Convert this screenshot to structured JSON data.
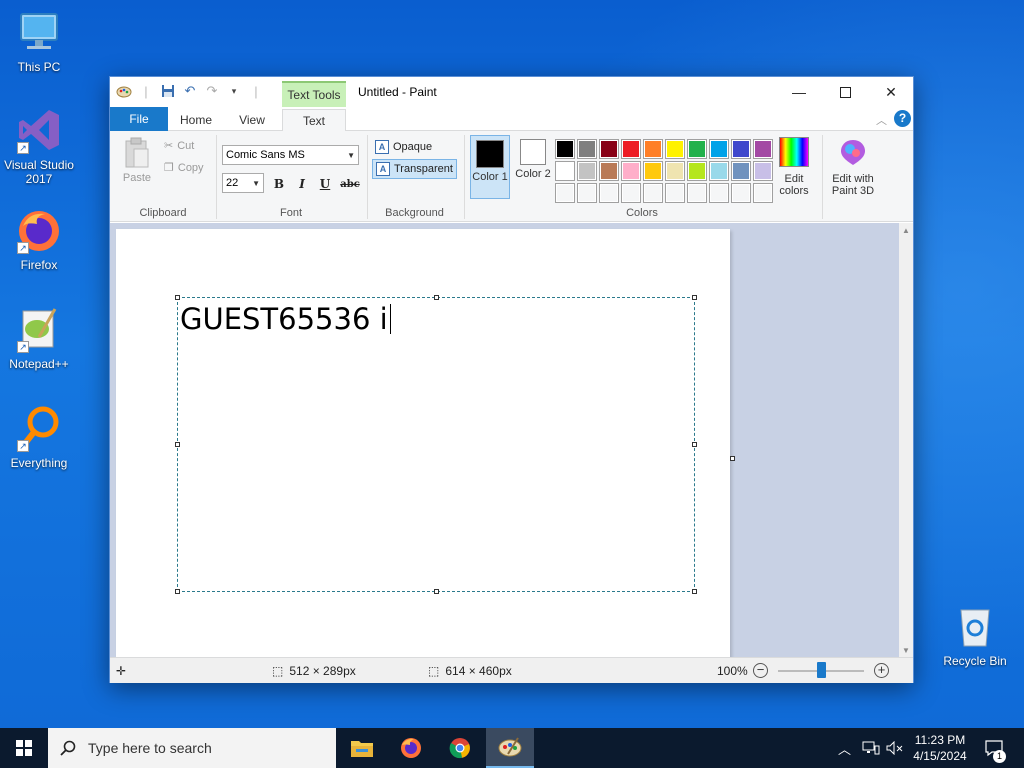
{
  "desktop": {
    "icons": [
      {
        "label": "This PC"
      },
      {
        "label": "Visual Studio 2017"
      },
      {
        "label": "Firefox"
      },
      {
        "label": "Notepad++"
      },
      {
        "label": "Everything"
      },
      {
        "label": "Recycle Bin"
      }
    ]
  },
  "window": {
    "title": "Untitled - Paint",
    "context_tab": "Text Tools",
    "tabs": [
      "File",
      "Home",
      "View",
      "Text"
    ]
  },
  "ribbon": {
    "clipboard": {
      "paste": "Paste",
      "cut": "Cut",
      "copy": "Copy",
      "group": "Clipboard"
    },
    "font": {
      "family": "Comic Sans MS",
      "size": "22",
      "bold": "B",
      "italic": "I",
      "underline": "U",
      "strike": "abc",
      "group": "Font"
    },
    "background": {
      "opaque": "Opaque",
      "transparent": "Transparent",
      "group": "Background"
    },
    "colors": {
      "color1": "Color 1",
      "color2": "Color 2",
      "color1_value": "#000000",
      "color2_value": "#ffffff",
      "group": "Colors",
      "palette": [
        "#000000",
        "#7f7f7f",
        "#880015",
        "#ed1c24",
        "#ff7f27",
        "#fff200",
        "#22b14c",
        "#00a2e8",
        "#3f48cc",
        "#a349a4",
        "#ffffff",
        "#c3c3c3",
        "#b97a57",
        "#ffaec9",
        "#ffc90e",
        "#efe4b0",
        "#b5e61d",
        "#99d9ea",
        "#7092be",
        "#c8bfe7",
        "#ffffff",
        "#ffffff",
        "#ffffff",
        "#ffffff",
        "#ffffff",
        "#ffffff",
        "#ffffff",
        "#ffffff",
        "#ffffff",
        "#ffffff"
      ]
    },
    "edit_colors": "Edit colors",
    "edit_paint3d": "Edit with Paint 3D"
  },
  "canvas": {
    "typed_text": "GUEST65536 i"
  },
  "status": {
    "selection_size": "512 × 289px",
    "image_size": "614 × 460px",
    "zoom": "100%"
  },
  "taskbar": {
    "search_placeholder": "Type here to search",
    "time": "11:23 PM",
    "date": "4/15/2024",
    "notification_count": "1"
  }
}
